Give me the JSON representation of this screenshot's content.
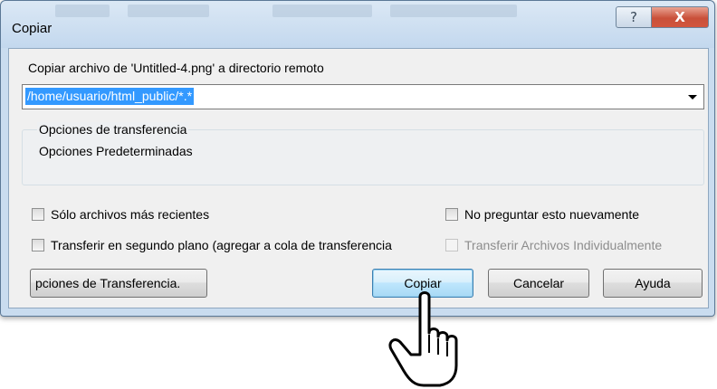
{
  "window": {
    "title": "Copiar"
  },
  "dialog": {
    "prompt": "Copiar archivo de 'Untitled-4.png' a directorio remoto",
    "path": {
      "value": "/home/usuario/html_public/*.*"
    },
    "transfer_group": {
      "heading": "Opciones de transferencia",
      "value": "Opciones Predeterminadas"
    },
    "checkboxes": {
      "newer_only": {
        "label": "Sólo archivos más recientes",
        "checked": false
      },
      "dont_ask": {
        "label": "No preguntar esto nuevamente",
        "checked": false
      },
      "background": {
        "label": "Transferir en segundo plano (agregar a cola de transferencia",
        "checked": false
      },
      "individually": {
        "label": "Transferir Archivos Individualmente",
        "checked": false,
        "enabled": false
      }
    },
    "buttons": {
      "transfer_options": "pciones de Transferencia.",
      "copy": "Copiar",
      "cancel": "Cancelar",
      "help": "Ayuda"
    }
  },
  "titlebar_buttons": {
    "help_glyph": "?",
    "close_glyph": "X"
  },
  "icons": {
    "cursor": "hand-pointer-icon",
    "dropdown": "chevron-down-icon"
  }
}
